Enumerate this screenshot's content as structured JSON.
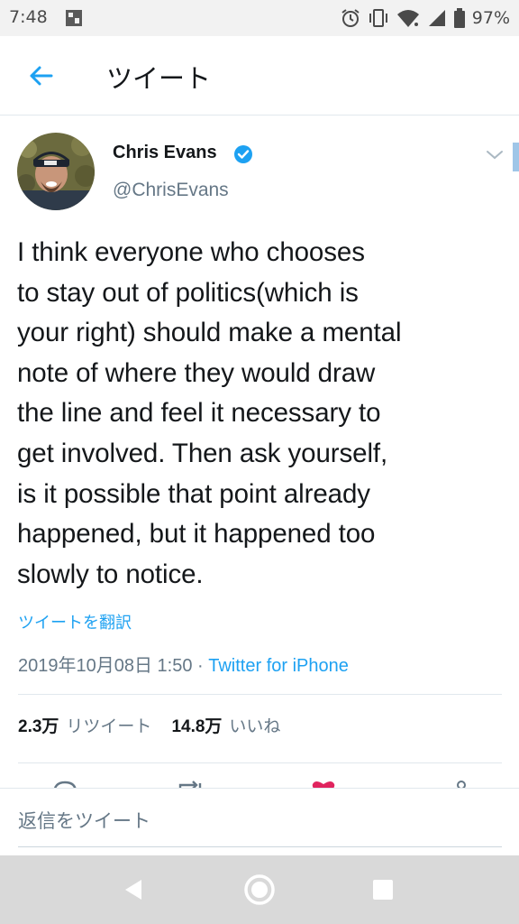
{
  "status_bar": {
    "time": "7:48",
    "battery": "97%",
    "icons": [
      "photo-icon",
      "alarm-icon",
      "vibrate-icon",
      "wifi-icon",
      "signal-icon",
      "battery-icon"
    ]
  },
  "app_bar": {
    "title": "ツイート",
    "back_icon": "arrow-left-icon"
  },
  "tweet": {
    "author_name": "Chris Evans",
    "handle": "@ChrisEvans",
    "verified": true,
    "text_lines": [
      "I think everyone who chooses",
      "to stay out of politics(which is",
      "your right) should make a mental",
      "note of where they would draw",
      "the line and feel it necessary to",
      "get involved. Then ask yourself,",
      "is it possible that point already",
      "happened, but it happened too",
      "slowly to notice."
    ],
    "translate_label": "ツイートを翻訳",
    "timestamp": "2019年10月08日 1:50",
    "separator": " · ",
    "source": "Twitter for iPhone",
    "retweet_count": "2.3万",
    "retweet_label": "リツイート",
    "like_count": "14.8万",
    "like_label": "いいね"
  },
  "reply": {
    "placeholder": "返信をツイート"
  },
  "colors": {
    "accent": "#1da1f2",
    "like": "#e0245e",
    "secondary_text": "#657786"
  }
}
